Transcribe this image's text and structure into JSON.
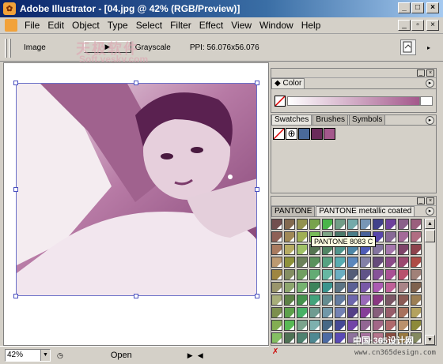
{
  "window": {
    "title": "Adobe Illustrator - [04.jpg @ 42% (RGB/Preview)]"
  },
  "menu": [
    "File",
    "Edit",
    "Object",
    "Type",
    "Select",
    "Filter",
    "Effect",
    "View",
    "Window",
    "Help"
  ],
  "control": {
    "label": "Image",
    "mode": "Grayscale",
    "ppi": "PPI: 56.076x56.076"
  },
  "watermark": {
    "cn": "天极软件",
    "en": "Soft.yesky.com"
  },
  "status": {
    "zoom": "42%",
    "state": "Open"
  },
  "panels": {
    "color": {
      "tab": "Color"
    },
    "swatches": {
      "tabs": [
        "Swatches",
        "Brushes",
        "Symbols"
      ]
    },
    "pantone": {
      "tabs": [
        "PANTONE",
        "PANTONE metallic coated"
      ],
      "tooltip": "PANTONE 8083 C"
    }
  },
  "bottom_watermark": {
    "cn": "中国·365设计网",
    "url": "www.cn365design.com"
  },
  "colors": {
    "accent": "#0a246a",
    "tint": "#a4588c"
  }
}
